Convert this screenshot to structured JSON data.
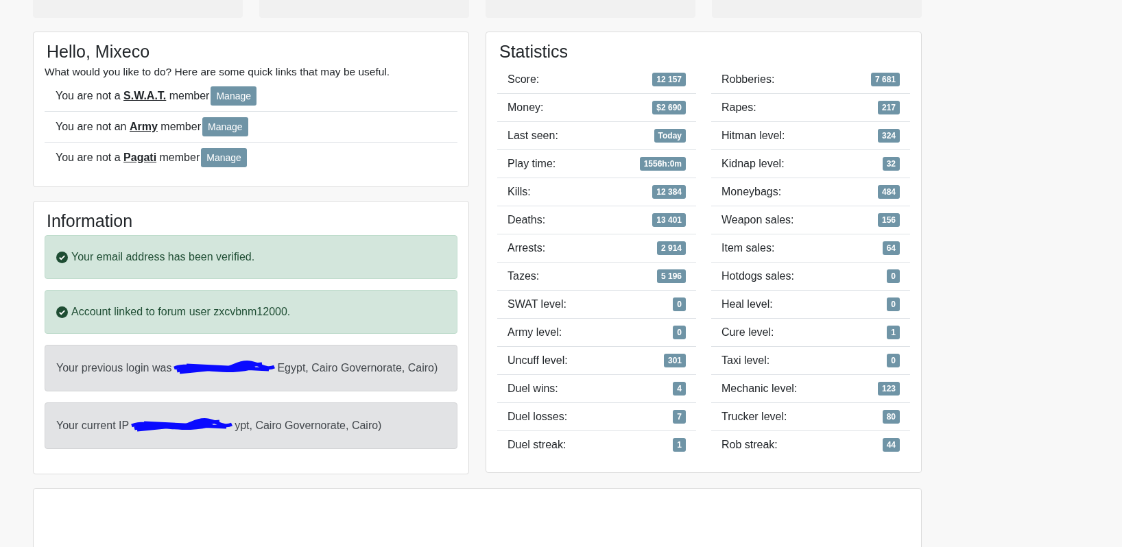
{
  "hello": {
    "title": "Hello, Mixeco",
    "intro": "What would you like to do? Here are some quick links that may be useful.",
    "memberships": [
      {
        "before": "You are not a",
        "group": "S.W.A.T.",
        "after": "member",
        "button": "Manage"
      },
      {
        "before": "You are not an",
        "group": "Army",
        "after": "member",
        "button": "Manage"
      },
      {
        "before": "You are not a",
        "group": "Pagati",
        "after": "member",
        "button": "Manage"
      }
    ]
  },
  "information": {
    "title": "Information",
    "alerts": [
      {
        "kind": "success",
        "text": "Your email address has been verified."
      },
      {
        "kind": "success",
        "text": "Account linked to forum user zxcvbnm12000."
      },
      {
        "kind": "redacted",
        "before": "Your previous login was",
        "after": "Egypt, Cairo Governorate, Cairo)"
      },
      {
        "kind": "redacted",
        "before": "Your current IP",
        "after": "ypt, Cairo Governorate, Cairo)"
      }
    ]
  },
  "statistics": {
    "title": "Statistics",
    "columns": [
      [
        {
          "label": "Score:",
          "value": "12 157"
        },
        {
          "label": "Money:",
          "value": "$2 690"
        },
        {
          "label": "Last seen:",
          "value": "Today"
        },
        {
          "label": "Play time:",
          "value": "1556h:0m"
        },
        {
          "label": "Kills:",
          "value": "12 384"
        },
        {
          "label": "Deaths:",
          "value": "13 401"
        },
        {
          "label": "Arrests:",
          "value": "2 914"
        },
        {
          "label": "Tazes:",
          "value": "5 196"
        },
        {
          "label": "SWAT level:",
          "value": "0"
        },
        {
          "label": "Army level:",
          "value": "0"
        },
        {
          "label": "Uncuff level:",
          "value": "301"
        },
        {
          "label": "Duel wins:",
          "value": "4"
        },
        {
          "label": "Duel losses:",
          "value": "7"
        },
        {
          "label": "Duel streak:",
          "value": "1"
        }
      ],
      [
        {
          "label": "Robberies:",
          "value": "7 681"
        },
        {
          "label": "Rapes:",
          "value": "217"
        },
        {
          "label": "Hitman level:",
          "value": "324"
        },
        {
          "label": "Kidnap level:",
          "value": "32"
        },
        {
          "label": "Moneybags:",
          "value": "484"
        },
        {
          "label": "Weapon sales:",
          "value": "156"
        },
        {
          "label": "Item sales:",
          "value": "64"
        },
        {
          "label": "Hotdogs sales:",
          "value": "0"
        },
        {
          "label": "Heal level:",
          "value": "0"
        },
        {
          "label": "Cure level:",
          "value": "1"
        },
        {
          "label": "Taxi level:",
          "value": "0"
        },
        {
          "label": "Mechanic level:",
          "value": "123"
        },
        {
          "label": "Trucker level:",
          "value": "80"
        },
        {
          "label": "Rob streak:",
          "value": "44"
        }
      ]
    ]
  }
}
